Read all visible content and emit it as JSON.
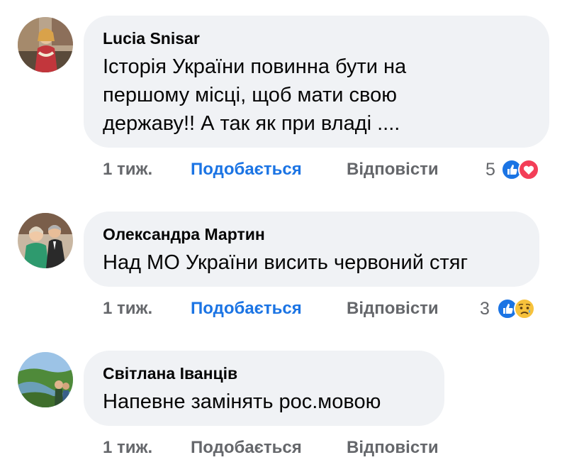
{
  "comments": [
    {
      "author": "Lucia Snisar",
      "text": "Історія України повинна бути на\nпершому місці, щоб мати свою\nдержаву!! А так як при владі ....",
      "time": "1 тиж.",
      "like_label": "Подобається",
      "reply_label": "Відповісти",
      "reaction_count": "5",
      "reactions": [
        "like-icon",
        "love-icon"
      ]
    },
    {
      "author": "Олександра Мартин",
      "text": "Над МО України висить червоний стяг",
      "time": "1 тиж.",
      "like_label": "Подобається",
      "reply_label": "Відповісти",
      "reaction_count": "3",
      "reactions": [
        "like-icon",
        "sad-icon"
      ]
    },
    {
      "author": "Світлана Іванців",
      "text": "Напевне замінять рос.мовою",
      "time": "1 тиж.",
      "like_label": "Подобається",
      "reply_label": "Відповісти"
    }
  ],
  "colors": {
    "like_active": "#1b74e4",
    "bubble_bg": "#f0f2f5",
    "meta_text": "#65676b"
  }
}
